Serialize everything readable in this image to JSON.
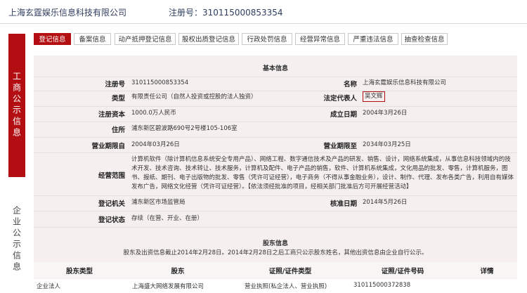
{
  "header": {
    "company_name": "上海玄霆娱乐信息科技有限公司",
    "reg_label": "注册号：",
    "reg_number": "310115000853354"
  },
  "sidebar": {
    "section1": "工商公示信息",
    "section2": "企业公示信息"
  },
  "tabs": [
    {
      "label": "登记信息",
      "active": true
    },
    {
      "label": "备案信息",
      "active": false
    },
    {
      "label": "动产抵押登记信息",
      "active": false
    },
    {
      "label": "股权出质登记信息",
      "active": false
    },
    {
      "label": "行政处罚信息",
      "active": false
    },
    {
      "label": "经营异常信息",
      "active": false
    },
    {
      "label": "严重违法信息",
      "active": false
    },
    {
      "label": "抽查检查信息",
      "active": false
    }
  ],
  "basic": {
    "title": "基本信息",
    "reg_no_label": "注册号",
    "reg_no": "310115000853354",
    "name_label": "名称",
    "name": "上海玄霆娱乐信息科技有限公司",
    "type_label": "类型",
    "type": "有限责任公司（自然人投资或控股的法人独资）",
    "rep_label": "法定代表人",
    "rep": "吴文辉",
    "capital_label": "注册资本",
    "capital": "1000.0万人民币",
    "est_label": "成立日期",
    "est": "2004年3月26日",
    "addr_label": "住所",
    "addr": "浦东新区碧波路690号2号楼105-106室",
    "term_from_label": "营业期限自",
    "term_from": "2004年03月26日",
    "term_to_label": "营业期限至",
    "term_to": "2034年03月25日",
    "scope_label": "经营范围",
    "scope": "计算机软件（除计算机信息系统安全专用产品）、网络工程、数字通信技术及产品的研发、销售、设计，网络系统集成，从事信息科技领域内的技术开发、技术咨询、技术转让、技术服务，计算机及配件、电子产品的销售，软件、计算机系统集成，文化用品的批发、零售，计算机服务，图书、报纸、期刊、电子出版物的批发、零售（凭许可证经营），电子商务（不得从事金融业务），设计、制作、代理、发布各类广告，利用自有媒体发布广告，网络文化经营（凭许可证经营）。【依法须经批准的项目，经相关部门批准后方可开展经营活动】",
    "auth_label": "登记机关",
    "auth": "浦东新区市场监管局",
    "approve_label": "核准日期",
    "approve": "2014年5月26日",
    "status_label": "登记状态",
    "status": "存续（在营、开业、在册）"
  },
  "shareholders": {
    "title": "股东信息",
    "note": "股东及出资信息截止2014年2月28日。2014年2月28日之后工商只公示股东姓名，其他出资信息由企业自行公示。",
    "columns": [
      "股东类型",
      "股东",
      "证照/证件类型",
      "证照/证件号码",
      "详情"
    ],
    "rows": [
      [
        "企业法人",
        "上海盛大网络发展有限公司",
        "营业执照(私企法人、营业执照)",
        "310115000372838",
        ""
      ]
    ]
  }
}
